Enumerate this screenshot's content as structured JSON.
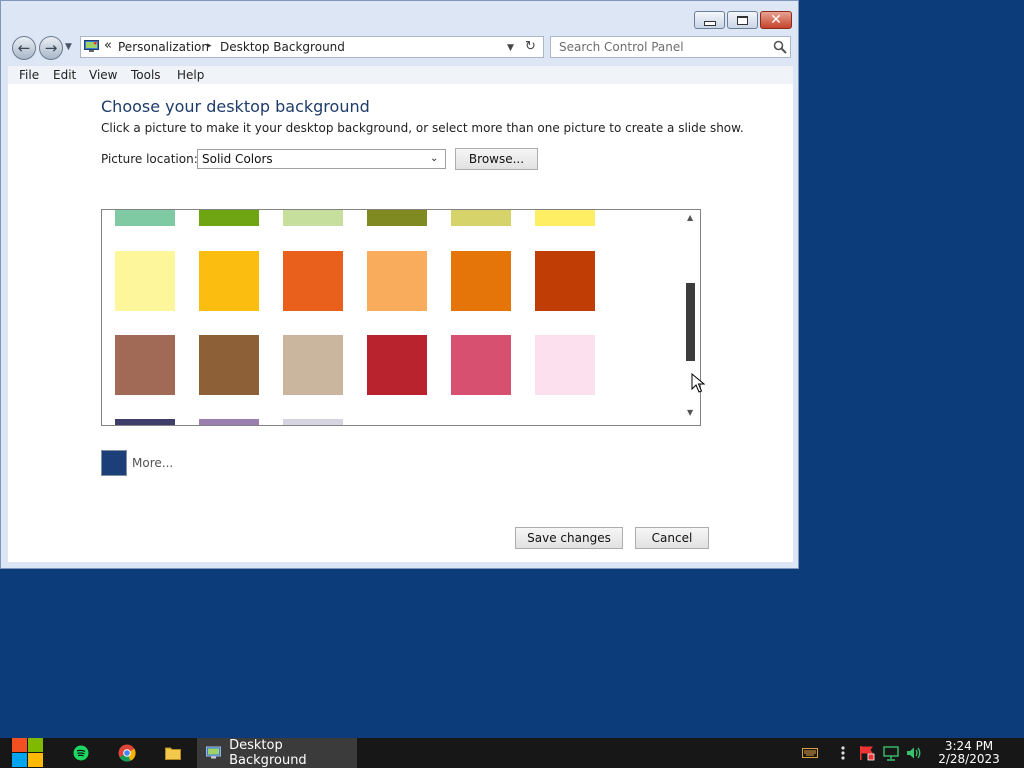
{
  "window": {
    "breadcrumb": {
      "prefix": "«",
      "items": [
        "Personalization",
        "Desktop Background"
      ],
      "separator": "▸"
    },
    "search": {
      "placeholder": "Search Control Panel"
    },
    "menu": [
      "File",
      "Edit",
      "View",
      "Tools",
      "Help"
    ]
  },
  "content": {
    "heading": "Choose your desktop background",
    "subheading": "Click a picture to make it your desktop background, or select more than one picture to create a slide show.",
    "location_label": "Picture location:",
    "location_value": "Solid Colors",
    "browse_label": "Browse...",
    "more_label": "More...",
    "more_color": "#1c3f7a",
    "save_label": "Save changes",
    "cancel_label": "Cancel",
    "scroll_position": 0.55,
    "swatch_rows": [
      [
        "#7fcaa3",
        "#6fa513",
        "#c6df9d",
        "#7f8a21",
        "#d6d36a",
        "#fdee63"
      ],
      [
        "#fef69b",
        "#fbbd10",
        "#e8601c",
        "#f9ac5c",
        "#e57509",
        "#c03d05"
      ],
      [
        "#a06a56",
        "#8d6038",
        "#cab59e",
        "#b9232e",
        "#d8506f",
        "#fde0ee"
      ],
      [
        "#3f3e6a",
        "#9b7fb0",
        "#d6d4e0"
      ]
    ]
  },
  "taskbar": {
    "active_window_label": "Desktop Background",
    "time": "3:24 PM",
    "date": "2/28/2023"
  }
}
